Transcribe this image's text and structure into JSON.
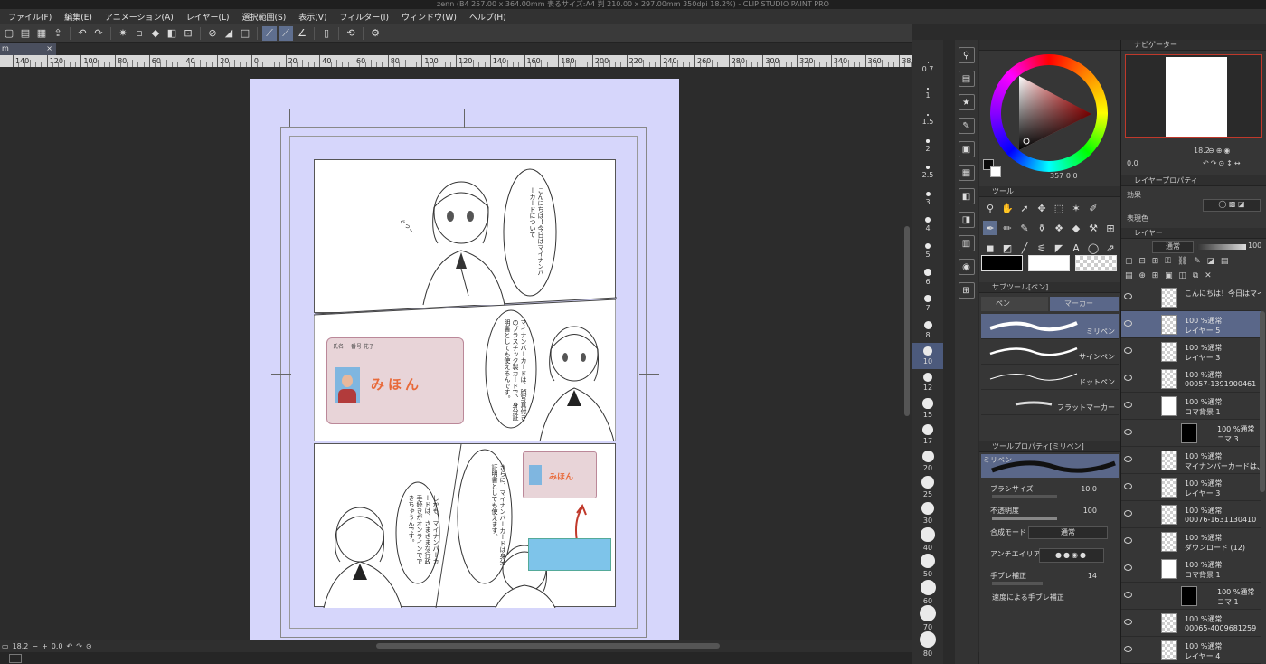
{
  "title": "zenn (B4 257.00 x 364.00mm 表るサイズ:A4 判 210.00 x 297.00mm 350dpi 18.2%) - CLIP STUDIO PAINT PRO",
  "menu": [
    "ファイル(F)",
    "編集(E)",
    "アニメーション(A)",
    "レイヤー(L)",
    "選択範囲(S)",
    "表示(V)",
    "フィルター(I)",
    "ウィンドウ(W)",
    "ヘルプ(H)"
  ],
  "toolbar_icons": [
    "new-icon",
    "open-icon",
    "save-icon",
    "export-icon",
    "undo-icon",
    "redo-icon",
    "transform-icon",
    "deselect-icon",
    "fill-icon",
    "invert-icon",
    "snap-ruler-icon",
    "snap-grid-icon",
    "special-ruler-icon",
    "page-icon",
    "rotate-icon",
    "settings-icon"
  ],
  "doc_tab": {
    "label": "m",
    "close": "×"
  },
  "ruler_labels": [
    "140",
    "120",
    "100",
    "80",
    "60",
    "40",
    "20",
    "0",
    "20",
    "40",
    "60",
    "80",
    "100",
    "120",
    "140",
    "160",
    "180",
    "200",
    "220",
    "240",
    "260",
    "280",
    "300",
    "320",
    "340",
    "360",
    "380"
  ],
  "manga": {
    "panel1_text": "こんにちは！今日はマイナンバーカードについて",
    "panel1_sfx": "ぐっ…",
    "panel2_text": "マイナンバーカードは、顔写真付きのプラスチック製カードで、身分証明書としても使えるんです。",
    "card": {
      "label": "氏名",
      "name": "番号 花子",
      "stamp": "みほん"
    },
    "panel3a_text": "しかも、マイナンバーカードは、さまざまな行政手続きがオンラインでできちゃうんです。",
    "panel3b_text": "さらに、マイナンバーカードは身分証明書としても使えます。"
  },
  "bottombar": {
    "zoom": "18.2",
    "angle": "0.0"
  },
  "brush_sizes": [
    "0.7",
    "1",
    "1.5",
    "2",
    "2.5",
    "3",
    "4",
    "5",
    "6",
    "7",
    "8",
    "10",
    "12",
    "15",
    "17",
    "20",
    "25",
    "30",
    "40",
    "50",
    "60",
    "70",
    "80"
  ],
  "selected_brush_size": "10",
  "color_wheel": {
    "readout": "357",
    "v1": "0",
    "v2": "0",
    "fg": "#0a0a0a",
    "bg": "#ffffff"
  },
  "tool_panel": {
    "title": "ツール"
  },
  "subtool_panel": {
    "title": "サブツール[ペン]",
    "tabs": [
      "ペン",
      "マーカー"
    ],
    "brushes": [
      "ミリペン",
      "サインペン",
      "ドットペン",
      "フラットマーカー"
    ]
  },
  "tool_property": {
    "title": "ツールプロパティ[ミリペン]",
    "brush_name": "ミリペン",
    "brush_size_label": "ブラシサイズ",
    "brush_size_value": "10.0",
    "opacity_label": "不透明度",
    "opacity_value": "100",
    "blend_label": "合成モード",
    "blend_value": "通常",
    "aa_label": "アンチエイリアス",
    "stab_label": "手ブレ補正",
    "stab_value": "14",
    "speed_label": "速度による手ブレ補正"
  },
  "navigator": {
    "title": "ナビゲーター",
    "zoom": "18.2",
    "angle": "0.0"
  },
  "layer_property": {
    "title": "レイヤープロパティ",
    "effect": "効果",
    "expression": "表現色"
  },
  "layer_panel": {
    "title": "レイヤー",
    "blend": "通常",
    "opacity": "100",
    "layers": [
      {
        "l1": "こんにちは！今日はマイナン",
        "l2": "",
        "thumb": "chk",
        "indent": 0
      },
      {
        "l1": "100 %通常",
        "l2": "レイヤー 5",
        "thumb": "chk",
        "indent": 0,
        "sel": true
      },
      {
        "l1": "100 %通常",
        "l2": "レイヤー 3",
        "thumb": "chk",
        "indent": 0
      },
      {
        "l1": "100 %通常",
        "l2": "00057-1391900461",
        "thumb": "chk",
        "indent": 0
      },
      {
        "l1": "100 %通常",
        "l2": "コマ背景 1",
        "thumb": "white",
        "indent": 0
      },
      {
        "l1": "100 %通常",
        "l2": "コマ 3",
        "thumb": "blk",
        "indent": 1
      },
      {
        "l1": "100 %通常",
        "l2": "マイナンバーカードは、顔写真",
        "thumb": "chk",
        "indent": 0
      },
      {
        "l1": "100 %通常",
        "l2": "レイヤー 3",
        "thumb": "chk",
        "indent": 0
      },
      {
        "l1": "100 %通常",
        "l2": "00076-1631130410",
        "thumb": "chk",
        "indent": 0
      },
      {
        "l1": "100 %通常",
        "l2": "ダウンロード (12)",
        "thumb": "chk",
        "indent": 0
      },
      {
        "l1": "100 %通常",
        "l2": "コマ背景 1",
        "thumb": "white",
        "indent": 0
      },
      {
        "l1": "100 %通常",
        "l2": "コマ 1",
        "thumb": "blk",
        "indent": 1
      },
      {
        "l1": "100 %通常",
        "l2": "00065-4009681259",
        "thumb": "chk",
        "indent": 0
      },
      {
        "l1": "100 %通常",
        "l2": "レイヤー 4",
        "thumb": "chk",
        "indent": 0
      },
      {
        "l1": "100 %通常",
        "l2": "",
        "thumb": "chk",
        "indent": 0
      }
    ]
  }
}
